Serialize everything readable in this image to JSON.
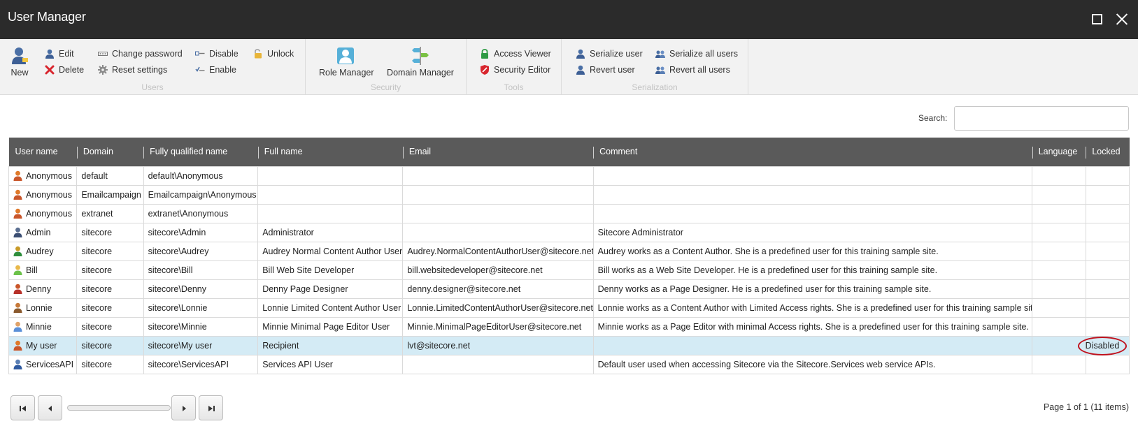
{
  "window": {
    "title": "User Manager"
  },
  "ribbon": {
    "users": {
      "label": "Users",
      "new": "New",
      "edit": "Edit",
      "delete": "Delete",
      "change_password": "Change password",
      "reset_settings": "Reset settings",
      "disable": "Disable",
      "enable": "Enable",
      "unlock": "Unlock"
    },
    "security": {
      "label": "Security",
      "role_manager": "Role Manager",
      "domain_manager": "Domain Manager"
    },
    "tools": {
      "label": "Tools",
      "access_viewer": "Access Viewer",
      "security_editor": "Security Editor"
    },
    "serialization": {
      "label": "Serialization",
      "serialize_user": "Serialize user",
      "revert_user": "Revert user",
      "serialize_all": "Serialize all users",
      "revert_all": "Revert all users"
    }
  },
  "search": {
    "label": "Search:",
    "value": ""
  },
  "table": {
    "columns": [
      "User name",
      "Domain",
      "Fully qualified name",
      "Full name",
      "Email",
      "Comment",
      "Language",
      "Locked"
    ],
    "rows": [
      {
        "icon": "user-icon-orange",
        "user": "Anonymous",
        "domain": "default",
        "fqn": "default\\Anonymous",
        "full": "",
        "email": "",
        "comment": "",
        "language": "",
        "locked": ""
      },
      {
        "icon": "user-icon-orange",
        "user": "Anonymous",
        "domain": "Emailcampaign",
        "fqn": "Emailcampaign\\Anonymous",
        "full": "",
        "email": "",
        "comment": "",
        "language": "",
        "locked": ""
      },
      {
        "icon": "user-icon-orange",
        "user": "Anonymous",
        "domain": "extranet",
        "fqn": "extranet\\Anonymous",
        "full": "",
        "email": "",
        "comment": "",
        "language": "",
        "locked": ""
      },
      {
        "icon": "user-icon-admin",
        "user": "Admin",
        "domain": "sitecore",
        "fqn": "sitecore\\Admin",
        "full": "Administrator",
        "email": "",
        "comment": "Sitecore Administrator",
        "language": "",
        "locked": ""
      },
      {
        "icon": "user-icon-green",
        "user": "Audrey",
        "domain": "sitecore",
        "fqn": "sitecore\\Audrey",
        "full": "Audrey Normal Content Author User",
        "email": "Audrey.NormalContentAuthorUser@sitecore.net",
        "comment": "Audrey works as a Content Author. She is a predefined user for this training sample site.",
        "language": "",
        "locked": ""
      },
      {
        "icon": "user-icon-green-light",
        "user": "Bill",
        "domain": "sitecore",
        "fqn": "sitecore\\Bill",
        "full": "Bill Web Site Developer",
        "email": "bill.websitedeveloper@sitecore.net",
        "comment": "Bill works as a Web Site Developer. He is a predefined user for this training sample site.",
        "language": "",
        "locked": ""
      },
      {
        "icon": "user-icon-red",
        "user": "Denny",
        "domain": "sitecore",
        "fqn": "sitecore\\Denny",
        "full": "Denny Page Designer",
        "email": "denny.designer@sitecore.net",
        "comment": "Denny works as a Page Designer. He is a predefined user for this training sample site.",
        "language": "",
        "locked": ""
      },
      {
        "icon": "user-icon-brown",
        "user": "Lonnie",
        "domain": "sitecore",
        "fqn": "sitecore\\Lonnie",
        "full": "Lonnie Limited Content Author User",
        "email": "Lonnie.LimitedContentAuthorUser@sitecore.net",
        "comment": "Lonnie works as a Content Author with Limited Access rights. She is a predefined user for this training sample site.",
        "language": "",
        "locked": ""
      },
      {
        "icon": "user-icon-blue",
        "user": "Minnie",
        "domain": "sitecore",
        "fqn": "sitecore\\Minnie",
        "full": "Minnie Minimal Page Editor User",
        "email": "Minnie.MinimalPageEditorUser@sitecore.net",
        "comment": "Minnie works as a Page Editor with minimal Access rights. She is a predefined user for this training sample site.",
        "language": "",
        "locked": ""
      },
      {
        "icon": "user-icon-orange",
        "user": "My user",
        "domain": "sitecore",
        "fqn": "sitecore\\My user",
        "full": "Recipient",
        "email": "lvt@sitecore.net",
        "comment": "",
        "language": "",
        "locked": "Disabled",
        "selected": true
      },
      {
        "icon": "user-icon-blue-dark",
        "user": "ServicesAPI",
        "domain": "sitecore",
        "fqn": "sitecore\\ServicesAPI",
        "full": "Services API User",
        "email": "",
        "comment": "Default user used when accessing Sitecore via the Sitecore.Services web service APIs.",
        "language": "",
        "locked": ""
      }
    ]
  },
  "pager": {
    "info": "Page 1 of 1 (11 items)"
  },
  "colors": {
    "titlebar": "#2b2b2b",
    "header": "#5a5a5a",
    "selected_row": "#d4ebf5",
    "highlight_ring": "#c0121d"
  }
}
